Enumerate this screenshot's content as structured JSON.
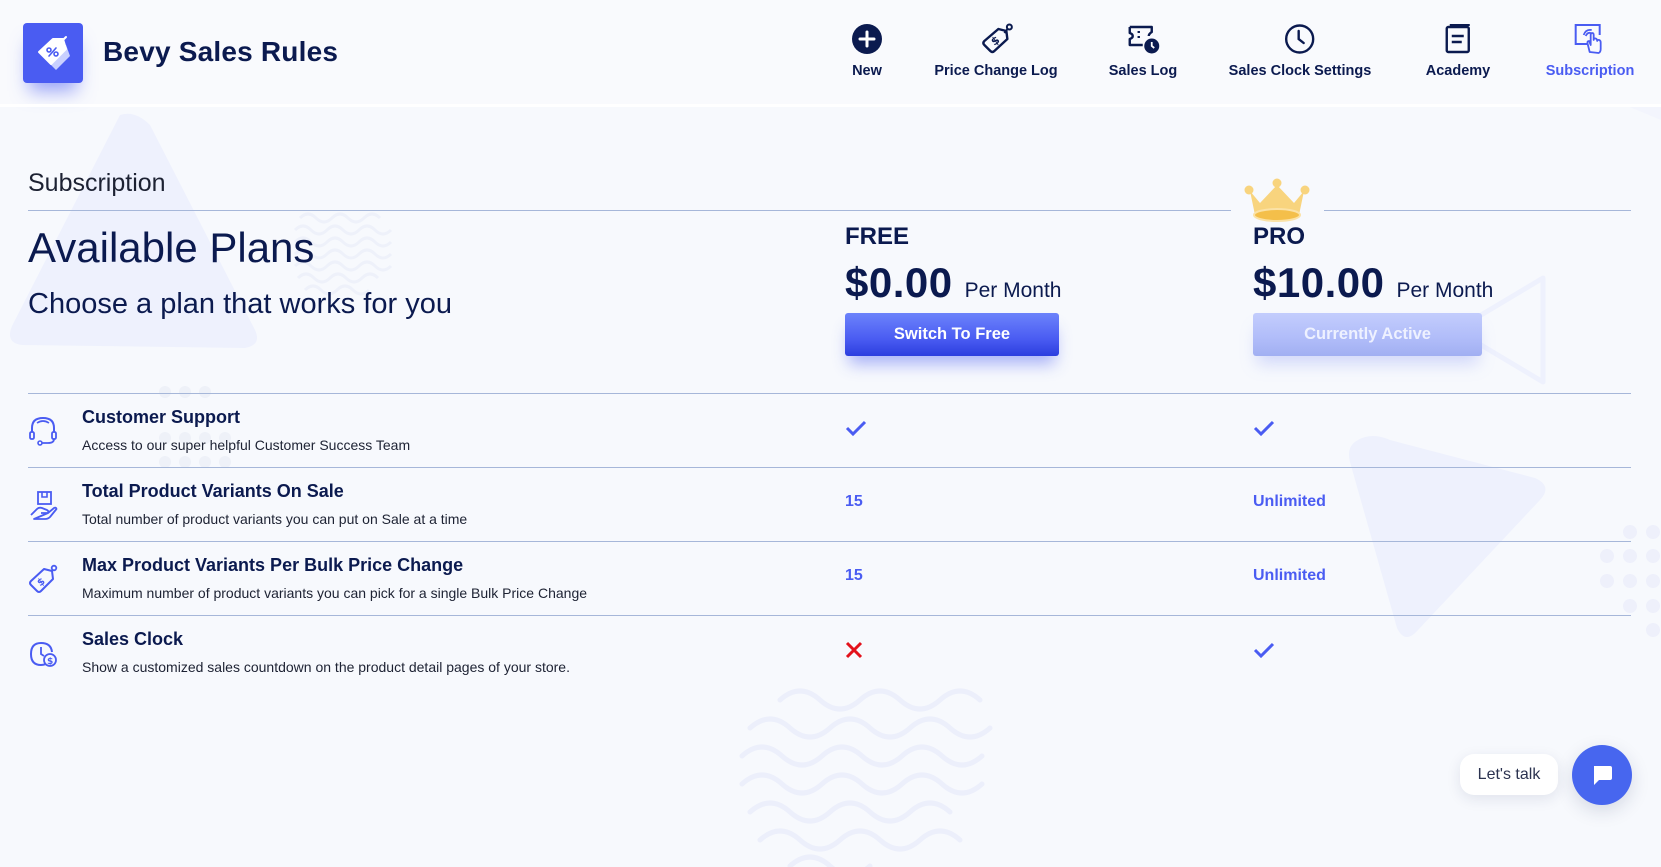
{
  "app": {
    "title": "Bevy Sales Rules",
    "logo_icon": "price-tag-percent-icon"
  },
  "nav": {
    "items": [
      {
        "label": "New",
        "icon": "plus-circle-icon",
        "active": false
      },
      {
        "label": "Price Change Log",
        "icon": "dollar-tag-icon",
        "active": false
      },
      {
        "label": "Sales Log",
        "icon": "ticket-clock-icon",
        "active": false
      },
      {
        "label": "Sales Clock Settings",
        "icon": "clock-icon",
        "active": false
      },
      {
        "label": "Academy",
        "icon": "book-icon",
        "active": false
      },
      {
        "label": "Subscription",
        "icon": "touch-screen-icon",
        "active": true
      }
    ]
  },
  "page": {
    "title": "Subscription",
    "heading": "Available Plans",
    "subheading": "Choose a plan that works for you"
  },
  "plans": [
    {
      "name": "FREE",
      "price": "$0.00",
      "period": "Per Month",
      "button_label": "Switch To Free",
      "current": false
    },
    {
      "name": "PRO",
      "price": "$10.00",
      "period": "Per Month",
      "button_label": "Currently Active",
      "current": true,
      "badge_icon": "crown-icon"
    }
  ],
  "features": [
    {
      "title": "Customer Support",
      "description": "Access to our super helpful Customer Success Team",
      "icon": "headset-icon",
      "free": "check",
      "pro": "check"
    },
    {
      "title": "Total Product Variants On Sale",
      "description": "Total number of product variants you can put on Sale at a time",
      "icon": "hand-box-icon",
      "free": "15",
      "pro": "Unlimited"
    },
    {
      "title": "Max Product Variants Per Bulk Price Change",
      "description": "Maximum number of product variants you can pick for a single Bulk Price Change",
      "icon": "dollar-tag-icon",
      "free": "15",
      "pro": "Unlimited"
    },
    {
      "title": "Sales Clock",
      "description": "Show a customized sales countdown on the product detail pages of your store.",
      "icon": "clock-dollar-icon",
      "free": "cross",
      "pro": "check"
    }
  ],
  "chat": {
    "label": "Let's talk",
    "icon": "chat-bubble-icon"
  },
  "colors": {
    "brand": "#4a5cf2",
    "navy": "#0b1a4f",
    "cross": "#e3111b",
    "crown": "#f6c65a"
  }
}
